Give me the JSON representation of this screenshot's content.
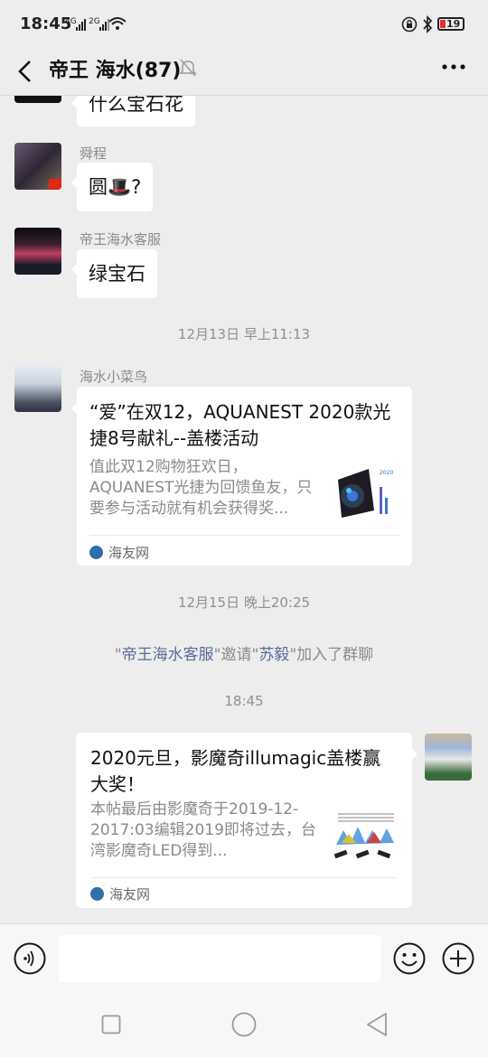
{
  "status_bar": {
    "time": "18:45",
    "net1": "4G",
    "net2": "2G",
    "battery": "19",
    "icons": [
      "signal-icon",
      "wifi-icon",
      "lock-rotation-icon",
      "bluetooth-icon",
      "battery-icon"
    ]
  },
  "header": {
    "back_icon": "chevron-left-icon",
    "title": "帝王 海水(87)",
    "mute_icon": "bell-muted-icon",
    "more_icon": "more-dots-icon"
  },
  "messages": [
    {
      "type": "text",
      "sender": "",
      "text": "什么宝石花"
    },
    {
      "type": "text",
      "sender": "舜程",
      "text": "圆🎩?"
    },
    {
      "type": "text",
      "sender": "帝王海水客服",
      "text": "绿宝石"
    },
    {
      "type": "time",
      "text": "12月13日 早上11:13"
    },
    {
      "type": "link",
      "sender": "海水小菜鸟",
      "title": "“爱”在双12，AQUANEST 2020款光捷8号献礼--盖楼活动",
      "desc": "值此双12购物狂欢日，AQUANEST光捷为回馈鱼友，只要参与活动就有机会获得奖...",
      "source": "海友网"
    },
    {
      "type": "time",
      "text": "12月15日 晚上20:25"
    },
    {
      "type": "system",
      "parts": [
        "\"",
        "帝王海水客服",
        "\"邀请\"",
        "苏毅",
        "\"加入了群聊"
      ]
    },
    {
      "type": "time",
      "text": "18:45"
    },
    {
      "type": "link",
      "sender": "",
      "title": "2020元旦，影魔奇illumagic盖楼赢大奖！",
      "desc": "本帖最后由影魔奇于2019-12-2017:03编辑2019即将过去，台湾影魔奇LED得到...",
      "source": "海友网"
    }
  ],
  "input_bar": {
    "voice_icon": "voice-icon",
    "text_value": "",
    "emoji_icon": "emoji-icon",
    "plus_icon": "plus-icon"
  },
  "system_nav": [
    "recent-apps-icon",
    "home-icon",
    "back-triangle-icon"
  ]
}
